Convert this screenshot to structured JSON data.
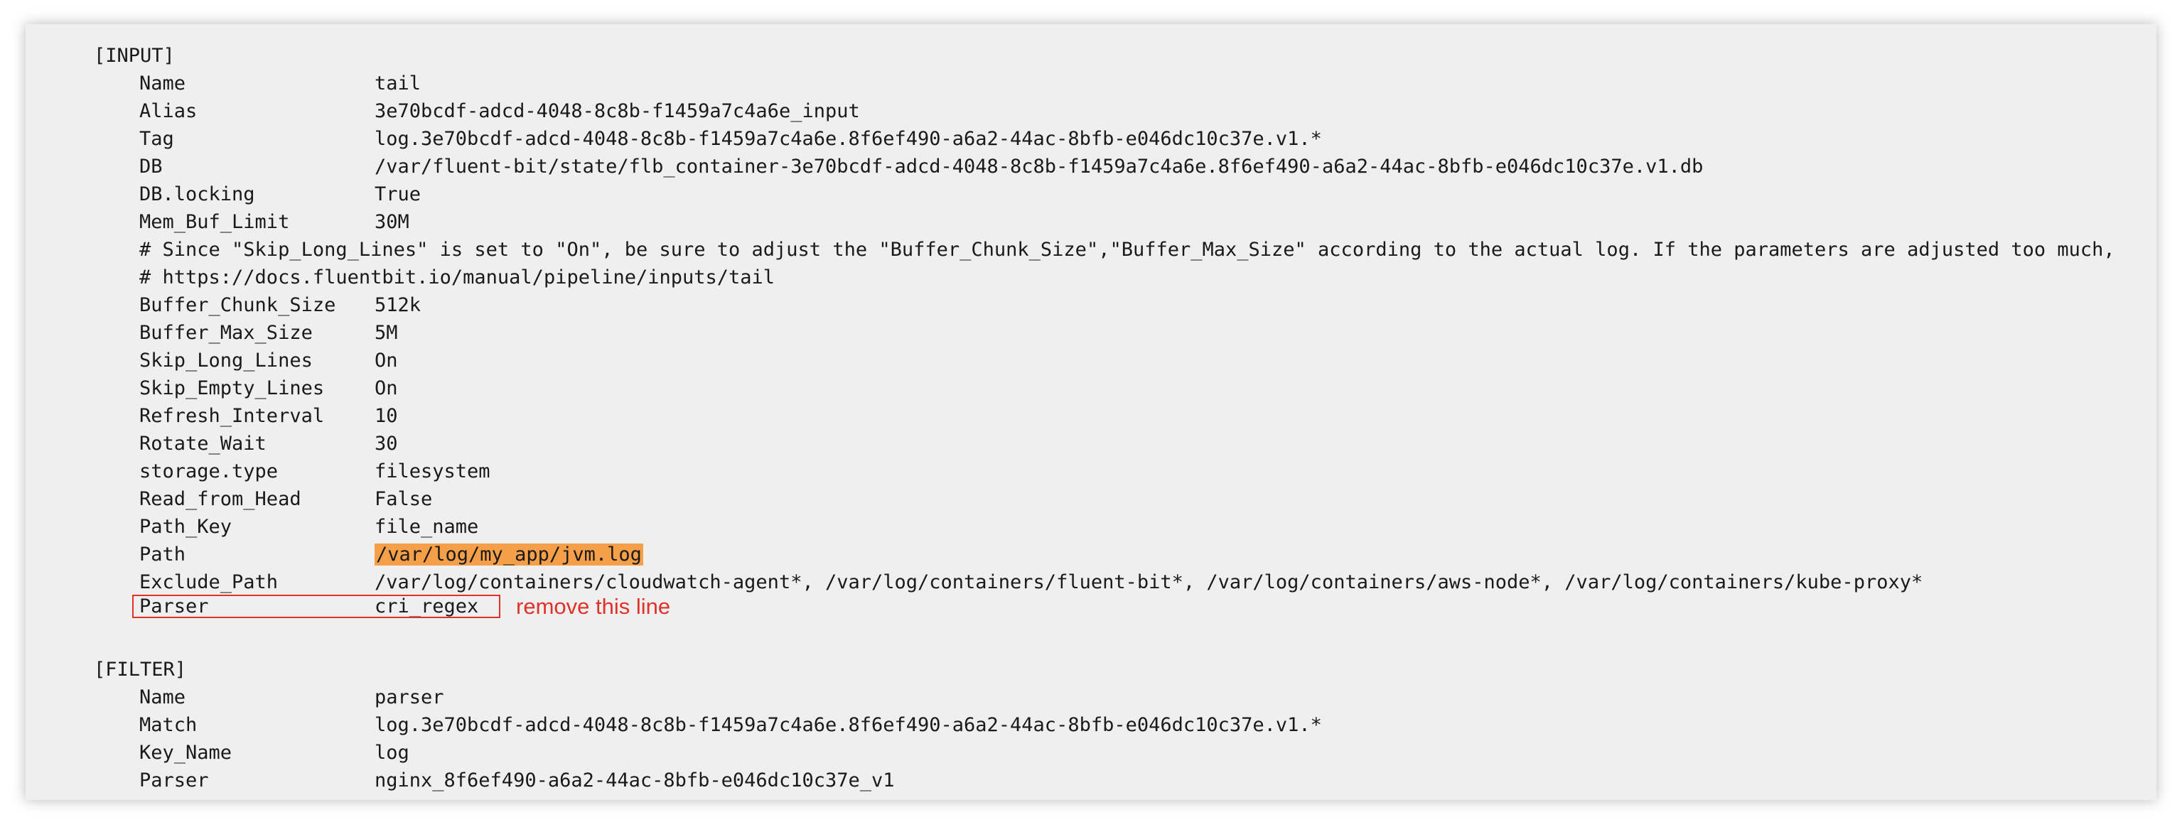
{
  "input": {
    "header": "[INPUT]",
    "rows": [
      {
        "key": "Name",
        "value": "tail"
      },
      {
        "key": "Alias",
        "value": "3e70bcdf-adcd-4048-8c8b-f1459a7c4a6e_input"
      },
      {
        "key": "Tag",
        "value": "log.3e70bcdf-adcd-4048-8c8b-f1459a7c4a6e.8f6ef490-a6a2-44ac-8bfb-e046dc10c37e.v1.*"
      },
      {
        "key": "DB",
        "value": "/var/fluent-bit/state/flb_container-3e70bcdf-adcd-4048-8c8b-f1459a7c4a6e.8f6ef490-a6a2-44ac-8bfb-e046dc10c37e.v1.db"
      },
      {
        "key": "DB.locking",
        "value": "True"
      },
      {
        "key": "Mem_Buf_Limit",
        "value": "30M"
      }
    ],
    "comments": [
      "# Since \"Skip_Long_Lines\" is set to \"On\", be sure to adjust the \"Buffer_Chunk_Size\",\"Buffer_Max_Size\" according to the actual log. If the parameters are adjusted too much,",
      "# https://docs.fluentbit.io/manual/pipeline/inputs/tail"
    ],
    "rows2": [
      {
        "key": "Buffer_Chunk_Size",
        "value": "512k"
      },
      {
        "key": "Buffer_Max_Size",
        "value": "5M"
      },
      {
        "key": "Skip_Long_Lines",
        "value": "On"
      },
      {
        "key": "Skip_Empty_Lines",
        "value": "On"
      },
      {
        "key": "Refresh_Interval",
        "value": "10"
      },
      {
        "key": "Rotate_Wait",
        "value": "30"
      },
      {
        "key": "storage.type",
        "value": "filesystem"
      },
      {
        "key": "Read_from_Head",
        "value": "False"
      },
      {
        "key": "Path_Key",
        "value": "file_name"
      },
      {
        "key": "Path",
        "value": "/var/log/my_app/jvm.log"
      },
      {
        "key": "Exclude_Path",
        "value": "/var/log/containers/cloudwatch-agent*, /var/log/containers/fluent-bit*, /var/log/containers/aws-node*, /var/log/containers/kube-proxy*"
      },
      {
        "key": "Parser",
        "value": "cri_regex"
      }
    ]
  },
  "annotation": {
    "note": "remove this line",
    "color": "#e0322a",
    "highlight_color": "#f5a048"
  },
  "filter": {
    "header": "[FILTER]",
    "rows": [
      {
        "key": "Name",
        "value": "parser"
      },
      {
        "key": "Match",
        "value": "log.3e70bcdf-adcd-4048-8c8b-f1459a7c4a6e.8f6ef490-a6a2-44ac-8bfb-e046dc10c37e.v1.*"
      },
      {
        "key": "Key_Name",
        "value": "log"
      },
      {
        "key": "Parser",
        "value": "nginx_8f6ef490-a6a2-44ac-8bfb-e046dc10c37e_v1"
      }
    ]
  }
}
